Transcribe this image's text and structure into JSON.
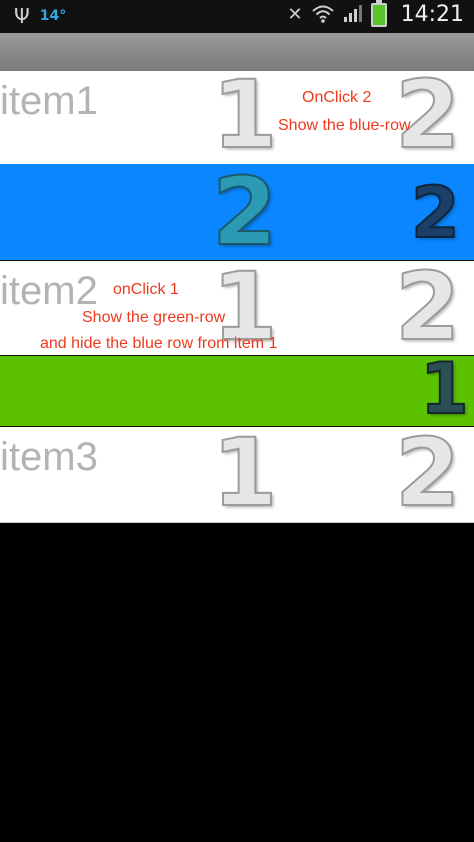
{
  "status_bar": {
    "temperature": "14°",
    "time": "14:21",
    "icons": [
      "usb-icon",
      "weather-temp",
      "mute-icon",
      "wifi-icon",
      "signal-icon",
      "battery-charging-icon"
    ]
  },
  "rows": [
    {
      "id": "item1",
      "label": "item1",
      "digit_left": "1",
      "digit_right": "2"
    },
    {
      "id": "blue-row",
      "digit_left": "2",
      "digit_right": "2",
      "color": "#0a87ff"
    },
    {
      "id": "item2",
      "label": "item2",
      "digit_left": "1",
      "digit_right": "2"
    },
    {
      "id": "green-row",
      "digit_right": "1",
      "color": "#5cc100"
    },
    {
      "id": "item3",
      "label": "item3",
      "digit_left": "1",
      "digit_right": "2"
    }
  ],
  "annotations": {
    "item1_line1": "OnClick 2",
    "item1_line2": "Show the blue-row",
    "item2_line1": "onClick 1",
    "item2_line2": "Show the green-row",
    "item2_line3": "and hide the blue row from item 1"
  }
}
